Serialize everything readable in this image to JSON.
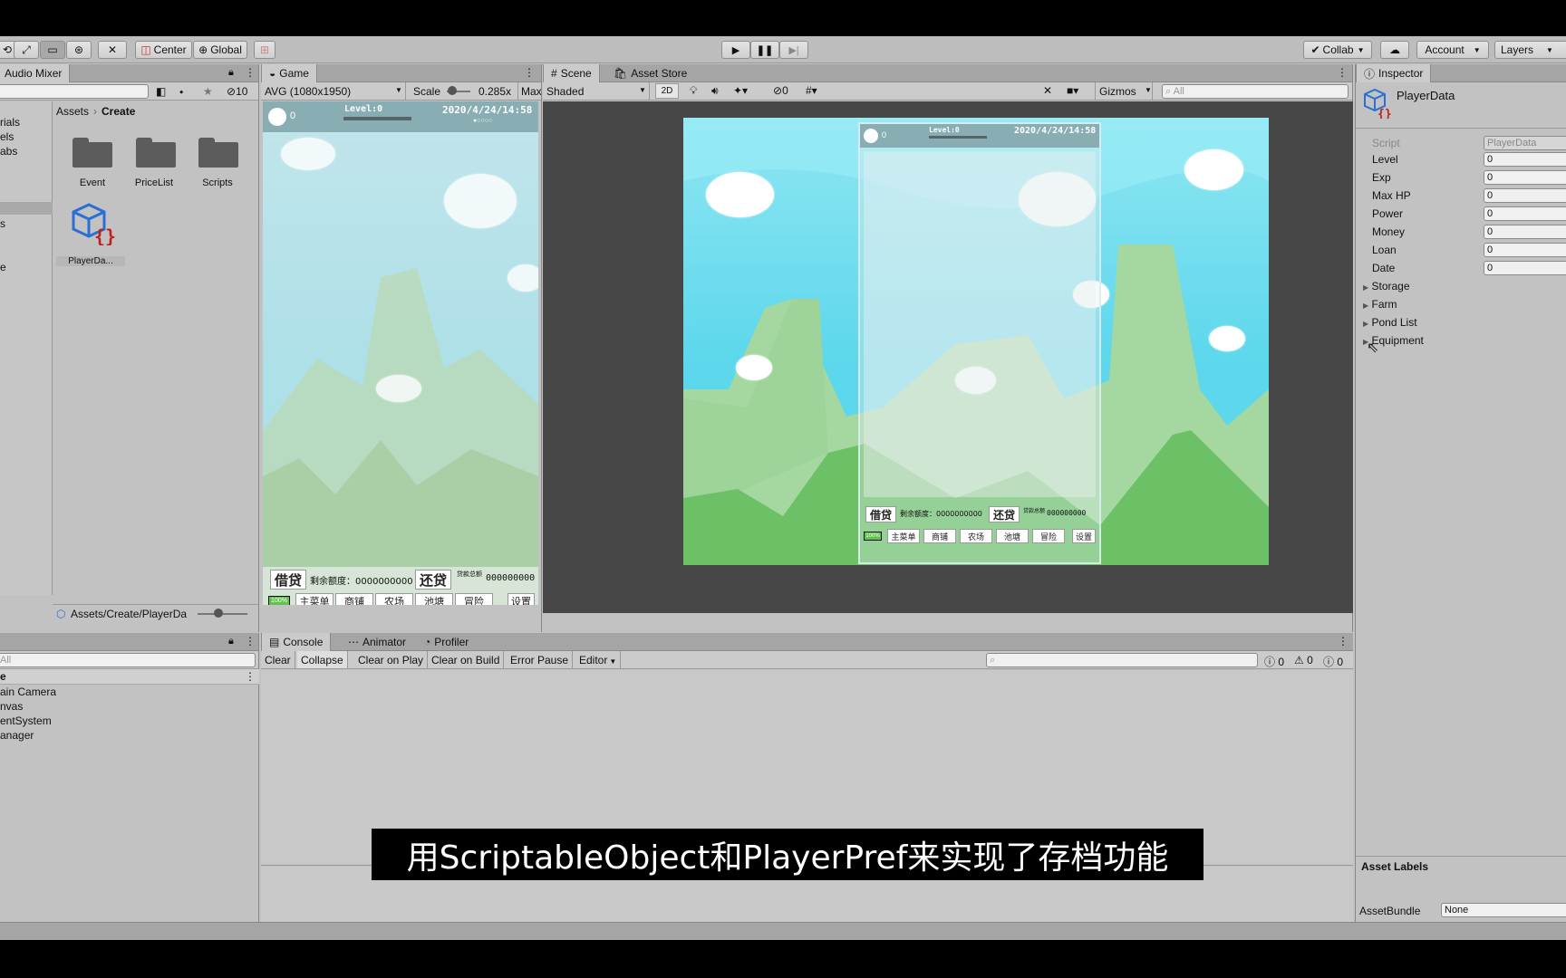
{
  "toolbar": {
    "center_label": "Center",
    "global_label": "Global",
    "collab_label": "Collab",
    "account_label": "Account",
    "layers_label": "Layers"
  },
  "project": {
    "tab_label": "Audio Mixer",
    "hidden_count": "10",
    "breadcrumb_root": "Assets",
    "breadcrumb_current": "Create",
    "tree_items": [
      "rials",
      "els",
      "abs",
      "s",
      "e"
    ],
    "assets": [
      {
        "name": "Event",
        "icon": "folder-icon"
      },
      {
        "name": "PriceList",
        "icon": "folder-icon"
      },
      {
        "name": "Scripts",
        "icon": "folder-icon"
      },
      {
        "name": "PlayerDa...",
        "icon": "scriptable-object-icon"
      }
    ],
    "footer_path": "Assets/Create/PlayerDa"
  },
  "hierarchy": {
    "search_placeholder": "All",
    "scene_name": "e",
    "items": [
      "ain Camera",
      "nvas",
      "entSystem",
      "anager"
    ]
  },
  "game": {
    "tab_label": "Game",
    "resolution": "AVG (1080x1950)",
    "scale_label": "Scale",
    "scale_value": "0.285x",
    "max_label": "Max"
  },
  "game_ui": {
    "coins": "0",
    "level": "Level:0",
    "datetime": "2020/4/24/14:58",
    "borrow": "借贷",
    "remaining": "剩余额度：0000000000",
    "repay": "还贷",
    "debt_note": "贷款总额",
    "debt_value": "000000000",
    "battery": "100%",
    "nav": [
      "主菜单",
      "商铺",
      "农场",
      "池塘",
      "冒险",
      "设置"
    ]
  },
  "scene": {
    "tab_label": "Scene",
    "asset_store_label": "Asset Store",
    "shading": "Shaded",
    "mode_2d": "2D",
    "hidden_count": "0",
    "gizmos_label": "Gizmos",
    "search_placeholder": "All"
  },
  "console": {
    "tab_label": "Console",
    "animator_label": "Animator",
    "profiler_label": "Profiler",
    "buttons": [
      "Clear",
      "Collapse",
      "Clear on Play",
      "Clear on Build",
      "Error Pause",
      "Editor"
    ],
    "log_count": "0",
    "warn_count": "0",
    "error_count": "0"
  },
  "inspector": {
    "tab_label": "Inspector",
    "object_name": "PlayerData",
    "script_label": "Script",
    "script_value": "PlayerData",
    "fields": [
      {
        "label": "Level",
        "value": "0"
      },
      {
        "label": "Exp",
        "value": "0"
      },
      {
        "label": "Max HP",
        "value": "0"
      },
      {
        "label": "Power",
        "value": "0"
      },
      {
        "label": "Money",
        "value": "0"
      },
      {
        "label": "Loan",
        "value": "0"
      },
      {
        "label": "Date",
        "value": "0"
      }
    ],
    "foldouts": [
      "Storage",
      "Farm",
      "Pond List",
      "Equipment"
    ],
    "asset_labels": "Asset Labels",
    "assetbundle_label": "AssetBundle",
    "assetbundle_value": "None"
  },
  "subtitle": "用ScriptableObject和PlayerPref来实现了存档功能"
}
